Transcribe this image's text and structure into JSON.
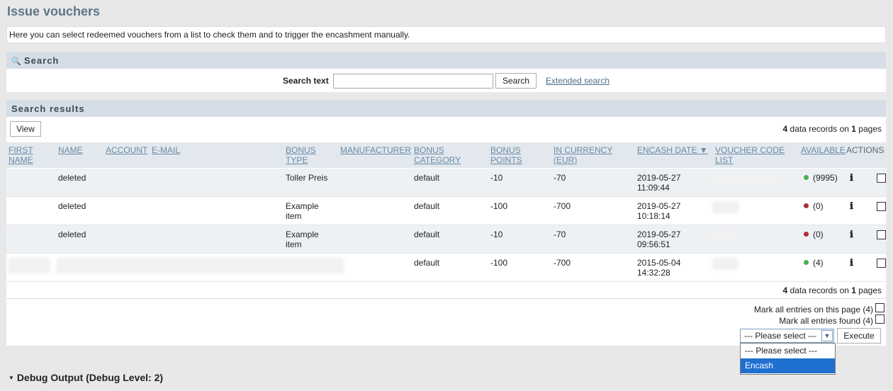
{
  "page": {
    "title": "Issue vouchers",
    "intro": "Here you can select redeemed vouchers from a list to check them and to trigger the encashment manually."
  },
  "search": {
    "section_title": "Search",
    "label": "Search text",
    "value": "",
    "placeholder": "",
    "button": "Search",
    "extended_link": "Extended search"
  },
  "results": {
    "section_title": "Search results",
    "view_button": "View",
    "record_count": "4",
    "records_text": "data records on",
    "page_count": "1",
    "pages_text": "pages",
    "columns": {
      "first_name": "FIRST NAME",
      "name": "NAME",
      "account": "ACCOUNT",
      "email": "E-MAIL",
      "bonus_type": "BONUS TYPE",
      "manufacturer": "MANUFACTURER",
      "bonus_category": "BONUS CATEGORY",
      "bonus_points": "BONUS POINTS",
      "in_currency": "IN CURRENCY (EUR)",
      "encash_date": "ENCASH DATE ▼",
      "voucher_code_list": "VOUCHER CODE LIST",
      "available": "AVAILABLE",
      "actions": "ACTIONS"
    },
    "rows": [
      {
        "name": "deleted",
        "bonus_type": "Toller Preis",
        "bonus_category": "default",
        "bonus_points": "-10",
        "in_currency": "-70",
        "encash_date": "2019-05-27",
        "encash_time": "11:09:44",
        "available": "(9995)",
        "status": "green"
      },
      {
        "name": "deleted",
        "bonus_type": "Example item",
        "bonus_category": "default",
        "bonus_points": "-100",
        "in_currency": "-700",
        "encash_date": "2019-05-27",
        "encash_time": "10:18:14",
        "available": "(0)",
        "status": "red"
      },
      {
        "name": "deleted",
        "bonus_type": "Example item",
        "bonus_category": "default",
        "bonus_points": "-10",
        "in_currency": "-70",
        "encash_date": "2019-05-27",
        "encash_time": "09:56:51",
        "available": "(0)",
        "status": "red"
      },
      {
        "name": "",
        "bonus_type": "",
        "bonus_category": "default",
        "bonus_points": "-100",
        "in_currency": "-700",
        "encash_date": "2015-05-04",
        "encash_time": "14:32:28",
        "available": "(4)",
        "status": "green"
      }
    ],
    "mark_page": "Mark all entries on this page (4)",
    "mark_found": "Mark all entries found (4)",
    "select_value": "--- Please select ---",
    "execute_button": "Execute",
    "dropdown_options": [
      "--- Please select ---",
      "Encash"
    ]
  },
  "debug": {
    "title": "Debug Output (Debug Level: 2)"
  },
  "colors": {
    "title": "#5c7688",
    "section_header": "#d5dee6",
    "status_green": "#4caf50",
    "status_red": "#b02e35",
    "dropdown_selected": "#1e6fd0"
  }
}
